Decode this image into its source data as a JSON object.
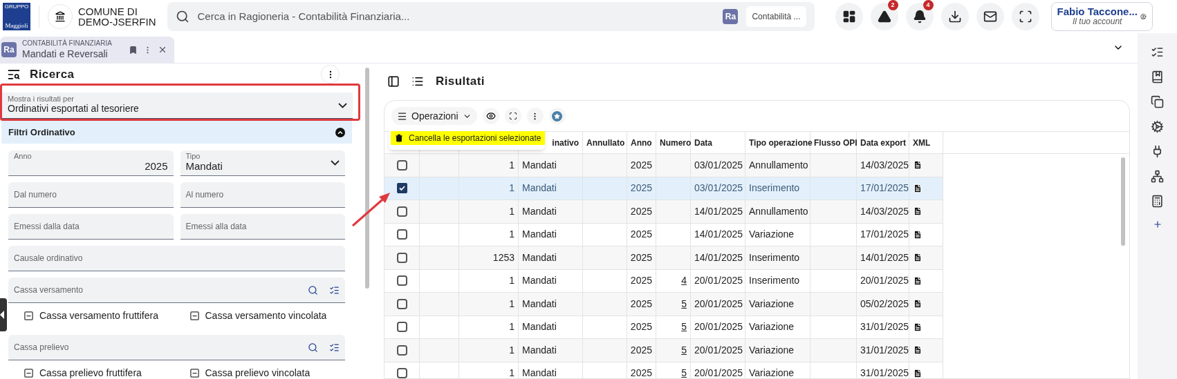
{
  "header": {
    "logo": {
      "top": "GRUPPO",
      "text": "Maggioli"
    },
    "entity": [
      "COMUNE DI",
      "DEMO-JSERFIN"
    ],
    "search": {
      "placeholder": "Cerca in Ragioneria - Contabilità Finanziaria...",
      "badge": "Ra",
      "scope": "Contabilità ..."
    },
    "actions": [
      {
        "kind": "dashboard"
      },
      {
        "kind": "warning",
        "count": "2"
      },
      {
        "kind": "bell",
        "count": "4"
      },
      {
        "kind": "download"
      },
      {
        "kind": "mail"
      },
      {
        "kind": "fullscreen"
      }
    ],
    "account": {
      "name": "Fabio Taccone...",
      "subtitle": "Il tuo account"
    }
  },
  "tab": {
    "badge": "Ra",
    "module": "CONTABILITÀ FINANZIARIA",
    "title": "Mandati e Reversali",
    "selected": true
  },
  "search_panel": {
    "title": "Ricerca",
    "show_results": {
      "label": "Mostra i risultati per",
      "value": "Ordinativi esportati al tesoriere",
      "highlighted": true
    },
    "filters": {
      "title": "Filtri Ordinativo",
      "expanded": true,
      "fields": [
        {
          "kind": "number",
          "label": "Anno",
          "value": "2025"
        },
        {
          "kind": "select",
          "label": "Tipo",
          "value": "Mandati"
        },
        {
          "kind": "input",
          "placeholder": "Dal numero"
        },
        {
          "kind": "input",
          "placeholder": "Al numero"
        },
        {
          "kind": "input",
          "placeholder": "Emessi dalla data"
        },
        {
          "kind": "input",
          "placeholder": "Emessi alla data"
        },
        {
          "kind": "wide",
          "placeholder": "Causale ordinativo"
        },
        {
          "kind": "lookup",
          "placeholder": "Cassa versamento",
          "options": [
            {
              "label": "Cassa versamento fruttifera",
              "indeterminate": true
            },
            {
              "label": "Cassa versamento vincolata",
              "indeterminate": true
            }
          ]
        },
        {
          "kind": "lookup",
          "placeholder": "Cassa prelievo",
          "options": [
            {
              "label": "Cassa prelievo fruttifera",
              "indeterminate": true
            },
            {
              "label": "Cassa prelievo vincolata",
              "indeterminate": true
            }
          ]
        }
      ]
    }
  },
  "results": {
    "title": "Risultati",
    "operations": "Operazioni",
    "menu": [
      {
        "label": "Cancella le esportazioni selezionate",
        "highlighted": true
      }
    ],
    "columns": [
      "inativo",
      "Annullato",
      "Anno",
      "Numero",
      "Data",
      "Tipo operazione",
      "Flusso OPI",
      "Data export",
      "XML"
    ],
    "rows": [
      {
        "selected": false,
        "number": "1",
        "type": "Mandati",
        "year": "2025",
        "date": "03/01/2025",
        "operation": "Annullamento",
        "export_date": "14/03/2025"
      },
      {
        "selected": true,
        "number": "1",
        "type": "Mandati",
        "year": "2025",
        "date": "03/01/2025",
        "operation": "Inserimento",
        "export_date": "17/01/2025"
      },
      {
        "selected": false,
        "number": "1",
        "type": "Mandati",
        "year": "2025",
        "date": "14/01/2025",
        "operation": "Annullamento",
        "export_date": "14/03/2025"
      },
      {
        "selected": false,
        "number": "1",
        "type": "Mandati",
        "year": "2025",
        "date": "14/01/2025",
        "operation": "Variazione",
        "export_date": "17/01/2025"
      },
      {
        "selected": false,
        "number": "1253",
        "type": "Mandati",
        "year": "2025",
        "date": "14/01/2025",
        "operation": "Inserimento",
        "export_date": "14/01/2025"
      },
      {
        "selected": false,
        "number": "1",
        "type": "Mandati",
        "year": "2025",
        "numero": "4",
        "date": "20/01/2025",
        "operation": "Inserimento",
        "export_date": "20/01/2025"
      },
      {
        "selected": false,
        "number": "1",
        "type": "Mandati",
        "year": "2025",
        "numero": "5",
        "date": "20/01/2025",
        "operation": "Variazione",
        "export_date": "05/02/2025"
      },
      {
        "selected": false,
        "number": "1",
        "type": "Mandati",
        "year": "2025",
        "numero": "5",
        "date": "20/01/2025",
        "operation": "Variazione",
        "export_date": "31/01/2025"
      },
      {
        "selected": false,
        "number": "1",
        "type": "Mandati",
        "year": "2025",
        "numero": "5",
        "date": "20/01/2025",
        "operation": "Variazione",
        "export_date": "31/01/2025"
      },
      {
        "selected": false,
        "number": "1",
        "type": "Mandati",
        "year": "2025",
        "numero": "5",
        "date": "20/01/2025",
        "operation": "Variazione",
        "export_date": "31/01/2025"
      }
    ]
  },
  "right_rail": [
    {
      "kind": "checklist"
    },
    {
      "kind": "bookmarks"
    },
    {
      "kind": "clipboard"
    },
    {
      "kind": "gear"
    },
    {
      "kind": "plug"
    },
    {
      "kind": "network"
    },
    {
      "kind": "calculator"
    },
    {
      "kind": "plus"
    }
  ]
}
